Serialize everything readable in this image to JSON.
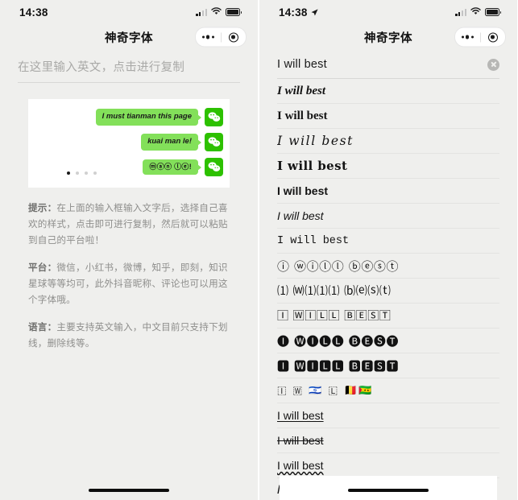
{
  "app": {
    "title": "神奇字体"
  },
  "left": {
    "status": {
      "time": "14:38",
      "signal_icon": "cellular-signal-icon",
      "wifi_icon": "wifi-icon",
      "battery_icon": "battery-icon"
    },
    "nav": {
      "title": "神奇字体",
      "menu_icon": "more-dots-icon",
      "capsule_icon": "target-circle-icon"
    },
    "input": {
      "placeholder": "在这里输入英文，点击进行复制",
      "value": ""
    },
    "card": {
      "avatar_icon": "wechat-logo-icon",
      "bubbles": [
        {
          "text": "I must tianman this page",
          "style": "bold-italic"
        },
        {
          "text": "kuai man le!",
          "style": "bold-italic"
        },
        {
          "text": "ⓜⓐⓝ ⓛⓔ!",
          "style": "circled"
        }
      ],
      "pager": {
        "count": 4,
        "active": 0
      }
    },
    "info": [
      {
        "label": "提示：",
        "text": "在上面的输入框输入文字后，选择自己喜欢的样式，点击即可进行复制，然后就可以粘贴到自己的平台啦！"
      },
      {
        "label": "平台：",
        "text": "微信，小红书，微博，知乎，即刻，知识星球等等均可，此外抖音昵称、评论也可以用这个字体哦。"
      },
      {
        "label": "语言：",
        "text": "主要支持英文输入，中文目前只支持下划线，删除线等。"
      }
    ],
    "home_indicator": "home-indicator"
  },
  "right": {
    "status": {
      "time": "14:38",
      "location_icon": "location-arrow-icon",
      "signal_icon": "cellular-signal-icon",
      "wifi_icon": "wifi-icon",
      "battery_icon": "battery-icon"
    },
    "nav": {
      "title": "神奇字体",
      "menu_icon": "more-dots-icon",
      "capsule_icon": "target-circle-icon"
    },
    "search": {
      "value": "I will best",
      "placeholder": "在这里输入英文，点击进行复制",
      "clear_icon": "clear-circle-icon"
    },
    "font_rows": [
      {
        "id": "bold-italic-serif",
        "text": "I will best"
      },
      {
        "id": "bold-serif",
        "text": "I will best"
      },
      {
        "id": "script",
        "text": "I will best"
      },
      {
        "id": "fraktur",
        "text": "I will best"
      },
      {
        "id": "bold-sans",
        "text": "I will best"
      },
      {
        "id": "italic-sans",
        "text": "I will best"
      },
      {
        "id": "monospace",
        "text": "I will best"
      },
      {
        "id": "circled",
        "text": "ⓘ ⓦⓘⓛⓛ ⓑⓔⓢⓣ"
      },
      {
        "id": "parenthesized",
        "text": "⑴ ⒲⑴⑴⑴ ⒝⒠⒮⒯"
      },
      {
        "id": "squared",
        "text": "🄸 🅆🄸🄻🄻 🄱🄴🅂🅃"
      },
      {
        "id": "filled-circled",
        "text": "🅘 🅦🅘🅛🅛 🅑🅔🅢🅣"
      },
      {
        "id": "filled-squared",
        "text": "🅸 🆆🅸🅻🅻 🅱🅴🆂🆃",
        "highlight_char": "B"
      },
      {
        "id": "regional-flags",
        "text": "🇮 🇼 🇮🇱 🇱 🇧🇪🇸🇹"
      },
      {
        "id": "double-struck",
        "text": "I will best"
      },
      {
        "id": "strikethrough",
        "text": "I will best"
      },
      {
        "id": "wavy-underline",
        "text": "I will best"
      },
      {
        "id": "slashed",
        "text": "I will best"
      }
    ],
    "home_indicator": "home-indicator"
  },
  "colors": {
    "screen_bg": "#efefed",
    "card_bg": "#ffffff",
    "bubble_green": "#83e05a",
    "wechat_green": "#2dc100",
    "text_primary": "#121212",
    "text_muted": "#8e8e8c",
    "divider": "#d8d8d6",
    "accent_red": "#e02020"
  }
}
